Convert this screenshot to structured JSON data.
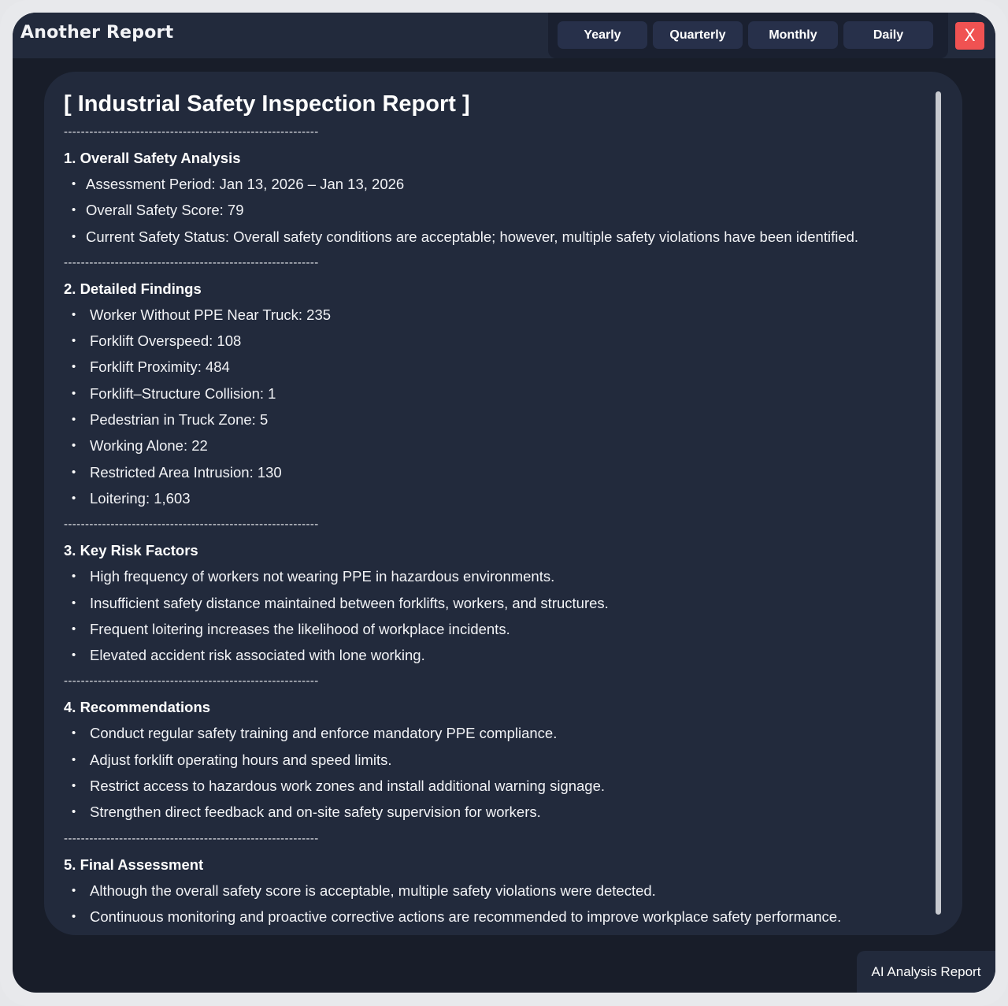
{
  "header": {
    "title": "Another Report",
    "tabs": [
      {
        "label": "Yearly"
      },
      {
        "label": "Quarterly"
      },
      {
        "label": "Monthly"
      },
      {
        "label": "Daily"
      }
    ],
    "close_label": "X"
  },
  "report": {
    "title": "[ Industrial Safety Inspection Report ]",
    "divider": "------------------------------------------------------------",
    "sections": [
      {
        "heading": "1. Overall Safety Analysis",
        "items": [
          "Assessment Period: Jan 13, 2026 – Jan 13, 2026",
          "Overall Safety Score: 79",
          "Current Safety Status: Overall safety conditions are acceptable; however, multiple safety violations have been identified."
        ]
      },
      {
        "heading": "2. Detailed Findings",
        "items": [
          "Worker Without PPE Near Truck: 235",
          "Forklift Overspeed: 108",
          "Forklift Proximity: 484",
          "Forklift–Structure Collision: 1",
          "Pedestrian in Truck Zone: 5",
          "Working Alone: 22",
          "Restricted Area Intrusion: 130",
          "Loitering: 1,603"
        ]
      },
      {
        "heading": "3. Key Risk Factors",
        "items": [
          "High frequency of workers not wearing PPE in hazardous environments.",
          "Insufficient safety distance maintained between forklifts, workers, and structures.",
          "Frequent loitering increases the likelihood of workplace incidents.",
          "Elevated accident risk associated with lone working."
        ]
      },
      {
        "heading": "4. Recommendations",
        "items": [
          "Conduct regular safety training and enforce mandatory PPE compliance.",
          "Adjust forklift operating hours and speed limits.",
          "Restrict access to hazardous work zones and install additional warning signage.",
          "Strengthen direct feedback and on-site safety supervision for workers."
        ]
      },
      {
        "heading": "5. Final Assessment",
        "items": [
          "Although the overall safety score is acceptable, multiple safety violations were detected.",
          "Continuous monitoring and proactive corrective actions are recommended to improve workplace safety performance."
        ]
      }
    ]
  },
  "footer": {
    "ai_report_label": "AI Analysis Report"
  }
}
